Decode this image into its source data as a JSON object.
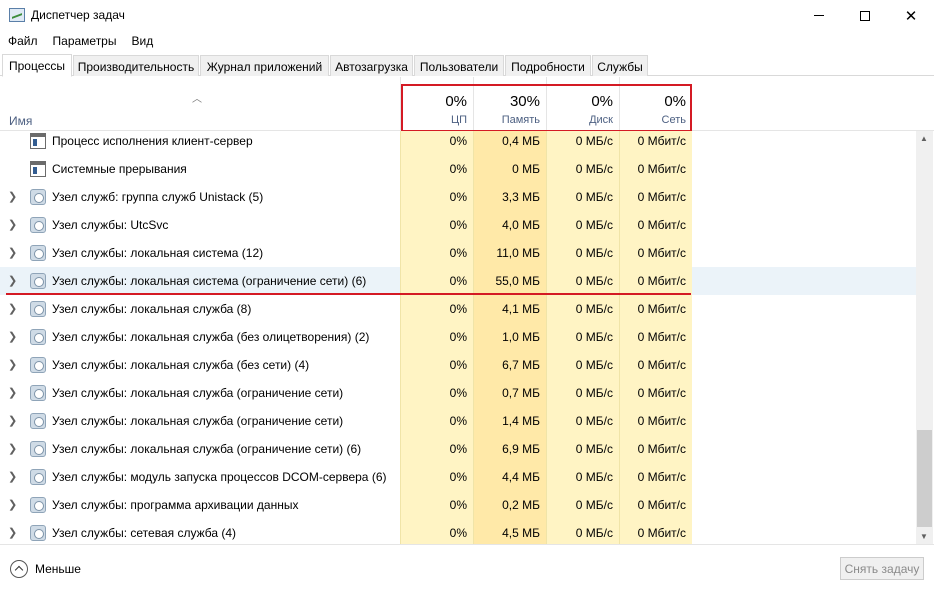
{
  "window": {
    "title": "Диспетчер задач"
  },
  "menu": [
    "Файл",
    "Параметры",
    "Вид"
  ],
  "tabs": [
    "Процессы",
    "Производительность",
    "Журнал приложений",
    "Автозагрузка",
    "Пользователи",
    "Подробности",
    "Службы"
  ],
  "active_tab": "Процессы",
  "columns": {
    "name": "Имя",
    "cpu": {
      "pct": "0%",
      "label": "ЦП"
    },
    "memory": {
      "pct": "30%",
      "label": "Память"
    },
    "disk": {
      "pct": "0%",
      "label": "Диск"
    },
    "network": {
      "pct": "0%",
      "label": "Сеть"
    }
  },
  "rows": [
    {
      "name": "Процесс исполнения клиент-сервер",
      "cpu": "0%",
      "mem": "0,4 МБ",
      "disk": "0 МБ/с",
      "net": "0 Мбит/с",
      "icon": "window-icon",
      "expandable": false
    },
    {
      "name": "Системные прерывания",
      "cpu": "0%",
      "mem": "0 МБ",
      "disk": "0 МБ/с",
      "net": "0 Мбит/с",
      "icon": "window-icon",
      "expandable": false
    },
    {
      "name": "Узел служб: группа служб Unistack (5)",
      "cpu": "0%",
      "mem": "3,3 МБ",
      "disk": "0 МБ/с",
      "net": "0 Мбит/с",
      "icon": "gear-icon",
      "expandable": true
    },
    {
      "name": "Узел службы: UtcSvc",
      "cpu": "0%",
      "mem": "4,0 МБ",
      "disk": "0 МБ/с",
      "net": "0 Мбит/с",
      "icon": "gear-icon",
      "expandable": true
    },
    {
      "name": "Узел службы: локальная система (12)",
      "cpu": "0%",
      "mem": "11,0 МБ",
      "disk": "0 МБ/с",
      "net": "0 Мбит/с",
      "icon": "gear-icon",
      "expandable": true
    },
    {
      "name": "Узел службы: локальная система (ограничение сети) (6)",
      "cpu": "0%",
      "mem": "55,0 МБ",
      "disk": "0 МБ/с",
      "net": "0 Мбит/с",
      "icon": "gear-icon",
      "expandable": true,
      "highlighted": true
    },
    {
      "name": "Узел службы: локальная служба (8)",
      "cpu": "0%",
      "mem": "4,1 МБ",
      "disk": "0 МБ/с",
      "net": "0 Мбит/с",
      "icon": "gear-icon",
      "expandable": true
    },
    {
      "name": "Узел службы: локальная служба (без олицетворения) (2)",
      "cpu": "0%",
      "mem": "1,0 МБ",
      "disk": "0 МБ/с",
      "net": "0 Мбит/с",
      "icon": "gear-icon",
      "expandable": true
    },
    {
      "name": "Узел службы: локальная служба (без сети) (4)",
      "cpu": "0%",
      "mem": "6,7 МБ",
      "disk": "0 МБ/с",
      "net": "0 Мбит/с",
      "icon": "gear-icon",
      "expandable": true
    },
    {
      "name": "Узел службы: локальная служба (ограничение сети)",
      "cpu": "0%",
      "mem": "0,7 МБ",
      "disk": "0 МБ/с",
      "net": "0 Мбит/с",
      "icon": "gear-icon",
      "expandable": true
    },
    {
      "name": "Узел службы: локальная служба (ограничение сети)",
      "cpu": "0%",
      "mem": "1,4 МБ",
      "disk": "0 МБ/с",
      "net": "0 Мбит/с",
      "icon": "gear-icon",
      "expandable": true
    },
    {
      "name": "Узел службы: локальная служба (ограничение сети) (6)",
      "cpu": "0%",
      "mem": "6,9 МБ",
      "disk": "0 МБ/с",
      "net": "0 Мбит/с",
      "icon": "gear-icon",
      "expandable": true
    },
    {
      "name": "Узел службы: модуль запуска процессов DCOM-сервера (6)",
      "cpu": "0%",
      "mem": "4,4 МБ",
      "disk": "0 МБ/с",
      "net": "0 Мбит/с",
      "icon": "gear-icon",
      "expandable": true
    },
    {
      "name": "Узел службы: программа архивации данных",
      "cpu": "0%",
      "mem": "0,2 МБ",
      "disk": "0 МБ/с",
      "net": "0 Мбит/с",
      "icon": "gear-icon",
      "expandable": true
    },
    {
      "name": "Узел службы: сетевая служба (4)",
      "cpu": "0%",
      "mem": "4,5 МБ",
      "disk": "0 МБ/с",
      "net": "0 Мбит/с",
      "icon": "gear-icon",
      "expandable": true
    }
  ],
  "footer": {
    "less_label": "Меньше",
    "end_task_label": "Снять задачу"
  },
  "colors": {
    "annotation_red": "#d41a24",
    "cell_yellow": "#fff4c4",
    "memory_yellow": "#ffe9a8",
    "selected_row": "#ebf3f9"
  }
}
